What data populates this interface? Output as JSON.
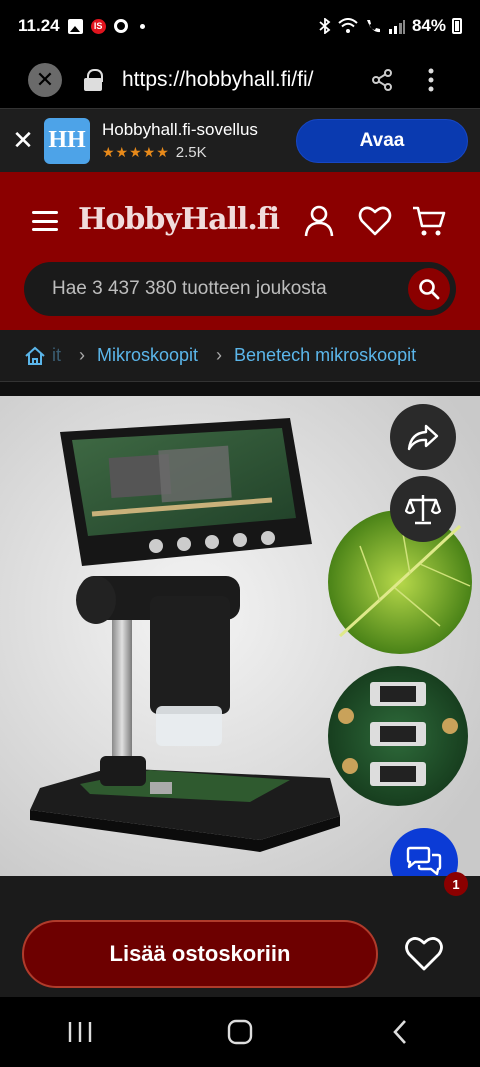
{
  "status_bar": {
    "time": "11.24",
    "battery": "84%",
    "icons": [
      "photo-icon",
      "is-app-icon",
      "chrome-icon",
      "dot-icon",
      "bluetooth-icon",
      "wifi-icon",
      "call-icon",
      "signal-icon",
      "battery-icon"
    ]
  },
  "browser": {
    "url": "https://hobbyhall.fi/fi/"
  },
  "app_banner": {
    "logo_text": "HH",
    "app_name": "Hobbyhall.fi-sovellus",
    "stars": "★★★★★",
    "rating_count": "2.5K",
    "open_label": "Avaa"
  },
  "header": {
    "logo": "HobbyHall.fi",
    "search_placeholder": "Hae 3 437 380 tuotteen joukosta"
  },
  "breadcrumb": {
    "faded": "it",
    "items": [
      "Mikroskoopit",
      "Benetech mikroskoopit"
    ]
  },
  "product": {
    "image_alt": "Digitaalinen mikroskooppi näytöllä"
  },
  "chat": {
    "badge_count": "1"
  },
  "actions": {
    "add_to_cart": "Lisää ostoskoriin"
  },
  "colors": {
    "brand_red": "#8b0000",
    "accent_blue": "#0b3bd6",
    "link_blue": "#5bb6ea"
  }
}
